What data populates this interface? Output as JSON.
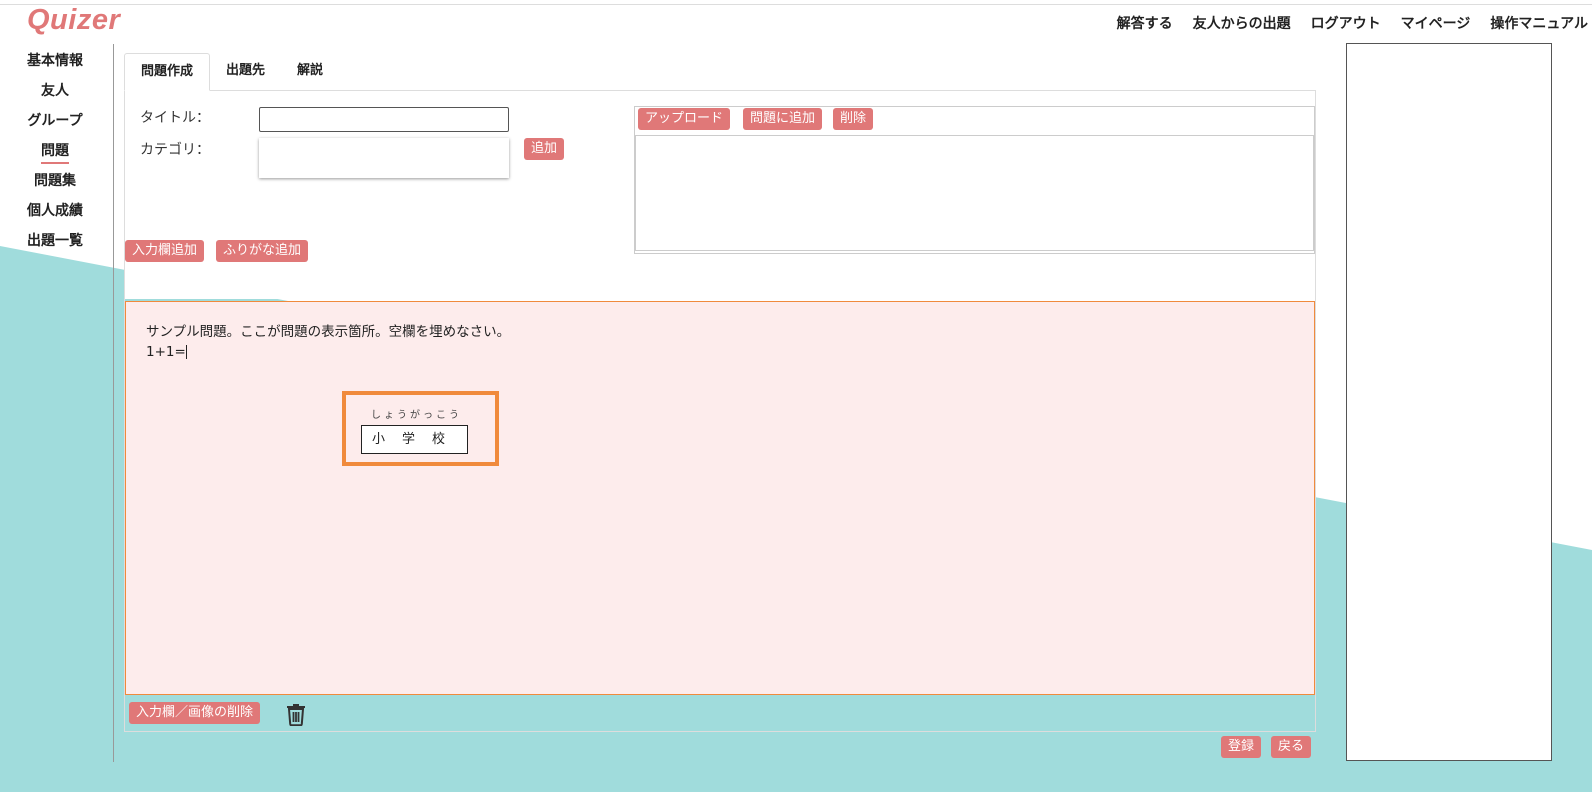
{
  "app": {
    "logo": "Quizer"
  },
  "colors": {
    "accent": "#e07878",
    "highlight": "#f08a3c",
    "teal": "#a0dcdc",
    "question_bg": "#fdecec"
  },
  "top_nav": [
    "解答する",
    "友人からの出題",
    "ログアウト",
    "マイページ",
    "操作マニュアル"
  ],
  "side_nav": {
    "items": [
      "基本情報",
      "友人",
      "グループ",
      "問題",
      "問題集",
      "個人成績",
      "出題一覧"
    ],
    "active": "問題"
  },
  "tabs": [
    "問題作成",
    "出題先",
    "解説"
  ],
  "active_tab": "問題作成",
  "form": {
    "title_label": "タイトル：",
    "title_value": "",
    "category_label": "カテゴリ：",
    "category_add_button": "追加"
  },
  "image_panel": {
    "buttons": [
      "アップロード",
      "問題に追加",
      "削除"
    ]
  },
  "editor_buttons": [
    "入力欄追加",
    "ふりがな追加"
  ],
  "question": {
    "line1": "サンプル問題。ここが問題の表示箇所。空欄を埋めなさい。",
    "line2": "1+1="
  },
  "furigana_field": {
    "reading": "しょうがっこう",
    "kanji": "小学校"
  },
  "bottom_actions": {
    "delete_button": "入力欄／画像の削除",
    "trash_icon": "trash-icon",
    "register_button": "登録",
    "back_button": "戻る"
  }
}
